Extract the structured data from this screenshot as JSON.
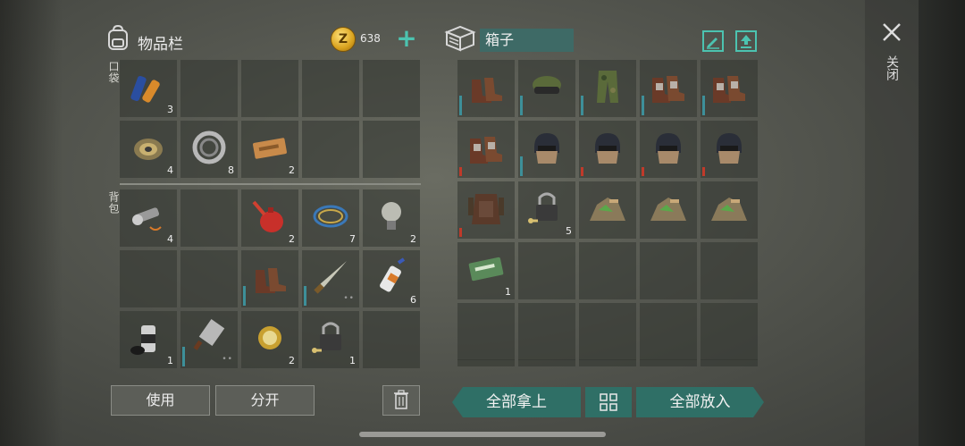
{
  "inventory": {
    "title": "物品栏",
    "coins": "638",
    "pocket_label": "口袋",
    "backpack_label": "背包",
    "pocket": [
      {
        "icon": "batteries-icon",
        "count": "3"
      },
      {
        "icon": "",
        "count": ""
      },
      {
        "icon": "",
        "count": ""
      },
      {
        "icon": "",
        "count": ""
      },
      {
        "icon": "",
        "count": ""
      },
      {
        "icon": "wire-spool-icon",
        "count": "4"
      },
      {
        "icon": "bearing-icon",
        "count": "8"
      },
      {
        "icon": "coupon-ticket-icon",
        "count": "2"
      },
      {
        "icon": "",
        "count": ""
      },
      {
        "icon": "",
        "count": ""
      }
    ],
    "backpack": [
      {
        "icon": "flashlight-icon",
        "count": "4"
      },
      {
        "icon": "",
        "count": ""
      },
      {
        "icon": "oil-can-icon",
        "count": "2"
      },
      {
        "icon": "cable-coil-icon",
        "count": "7"
      },
      {
        "icon": "light-bulb-icon",
        "count": "2"
      },
      {
        "icon": "",
        "count": ""
      },
      {
        "icon": "",
        "count": ""
      },
      {
        "icon": "boots-icon",
        "count": "",
        "dur": true
      },
      {
        "icon": "machete-icon",
        "count": "",
        "dur": true,
        "dots": true
      },
      {
        "icon": "glue-tube-icon",
        "count": "6"
      },
      {
        "icon": "spray-can-icon",
        "count": "1"
      },
      {
        "icon": "cleaver-icon",
        "count": "",
        "dur": true,
        "dots": true
      },
      {
        "icon": "wristwatch-icon",
        "count": "2"
      },
      {
        "icon": "padlock-key-icon",
        "count": "1"
      },
      {
        "icon": "",
        "count": ""
      }
    ]
  },
  "chest": {
    "name": "箱子",
    "items": [
      {
        "icon": "boots-icon",
        "count": "",
        "dur": "teal"
      },
      {
        "icon": "cap-goggles-icon",
        "count": "",
        "dur": "teal"
      },
      {
        "icon": "camo-pants-icon",
        "count": "",
        "dur": "teal"
      },
      {
        "icon": "armored-boots-icon",
        "count": "",
        "dur": "teal"
      },
      {
        "icon": "armored-boots-icon",
        "count": "",
        "dur": "teal"
      },
      {
        "icon": "armored-boots-icon",
        "count": "",
        "dur": "red"
      },
      {
        "icon": "riot-helmet-icon",
        "count": "",
        "dur": "teal"
      },
      {
        "icon": "riot-helmet-icon",
        "count": "",
        "dur": "red"
      },
      {
        "icon": "riot-helmet-icon",
        "count": "",
        "dur": "red"
      },
      {
        "icon": "riot-helmet-icon",
        "count": "",
        "dur": "red"
      },
      {
        "icon": "armor-vest-icon",
        "count": "",
        "dur": "red"
      },
      {
        "icon": "padlock-key-icon",
        "count": "5"
      },
      {
        "icon": "scrap-pile-icon",
        "count": ""
      },
      {
        "icon": "scrap-pile-icon",
        "count": ""
      },
      {
        "icon": "scrap-pile-icon",
        "count": ""
      },
      {
        "icon": "ration-coupon-icon",
        "count": "1"
      },
      {
        "icon": "",
        "count": ""
      },
      {
        "icon": "",
        "count": ""
      },
      {
        "icon": "",
        "count": ""
      },
      {
        "icon": "",
        "count": ""
      },
      {
        "icon": "",
        "count": ""
      },
      {
        "icon": "",
        "count": ""
      },
      {
        "icon": "",
        "count": ""
      },
      {
        "icon": "",
        "count": ""
      },
      {
        "icon": "",
        "count": ""
      }
    ]
  },
  "close_label": "关闭",
  "buttons": {
    "use": "使用",
    "split": "分开",
    "take_all": "全部拿上",
    "put_all": "全部放入"
  },
  "colors": {
    "accent": "#4cc3b0",
    "teal_button": "#2f6f66",
    "durability_teal": "#3d8f99",
    "durability_red": "#c03a2a"
  }
}
